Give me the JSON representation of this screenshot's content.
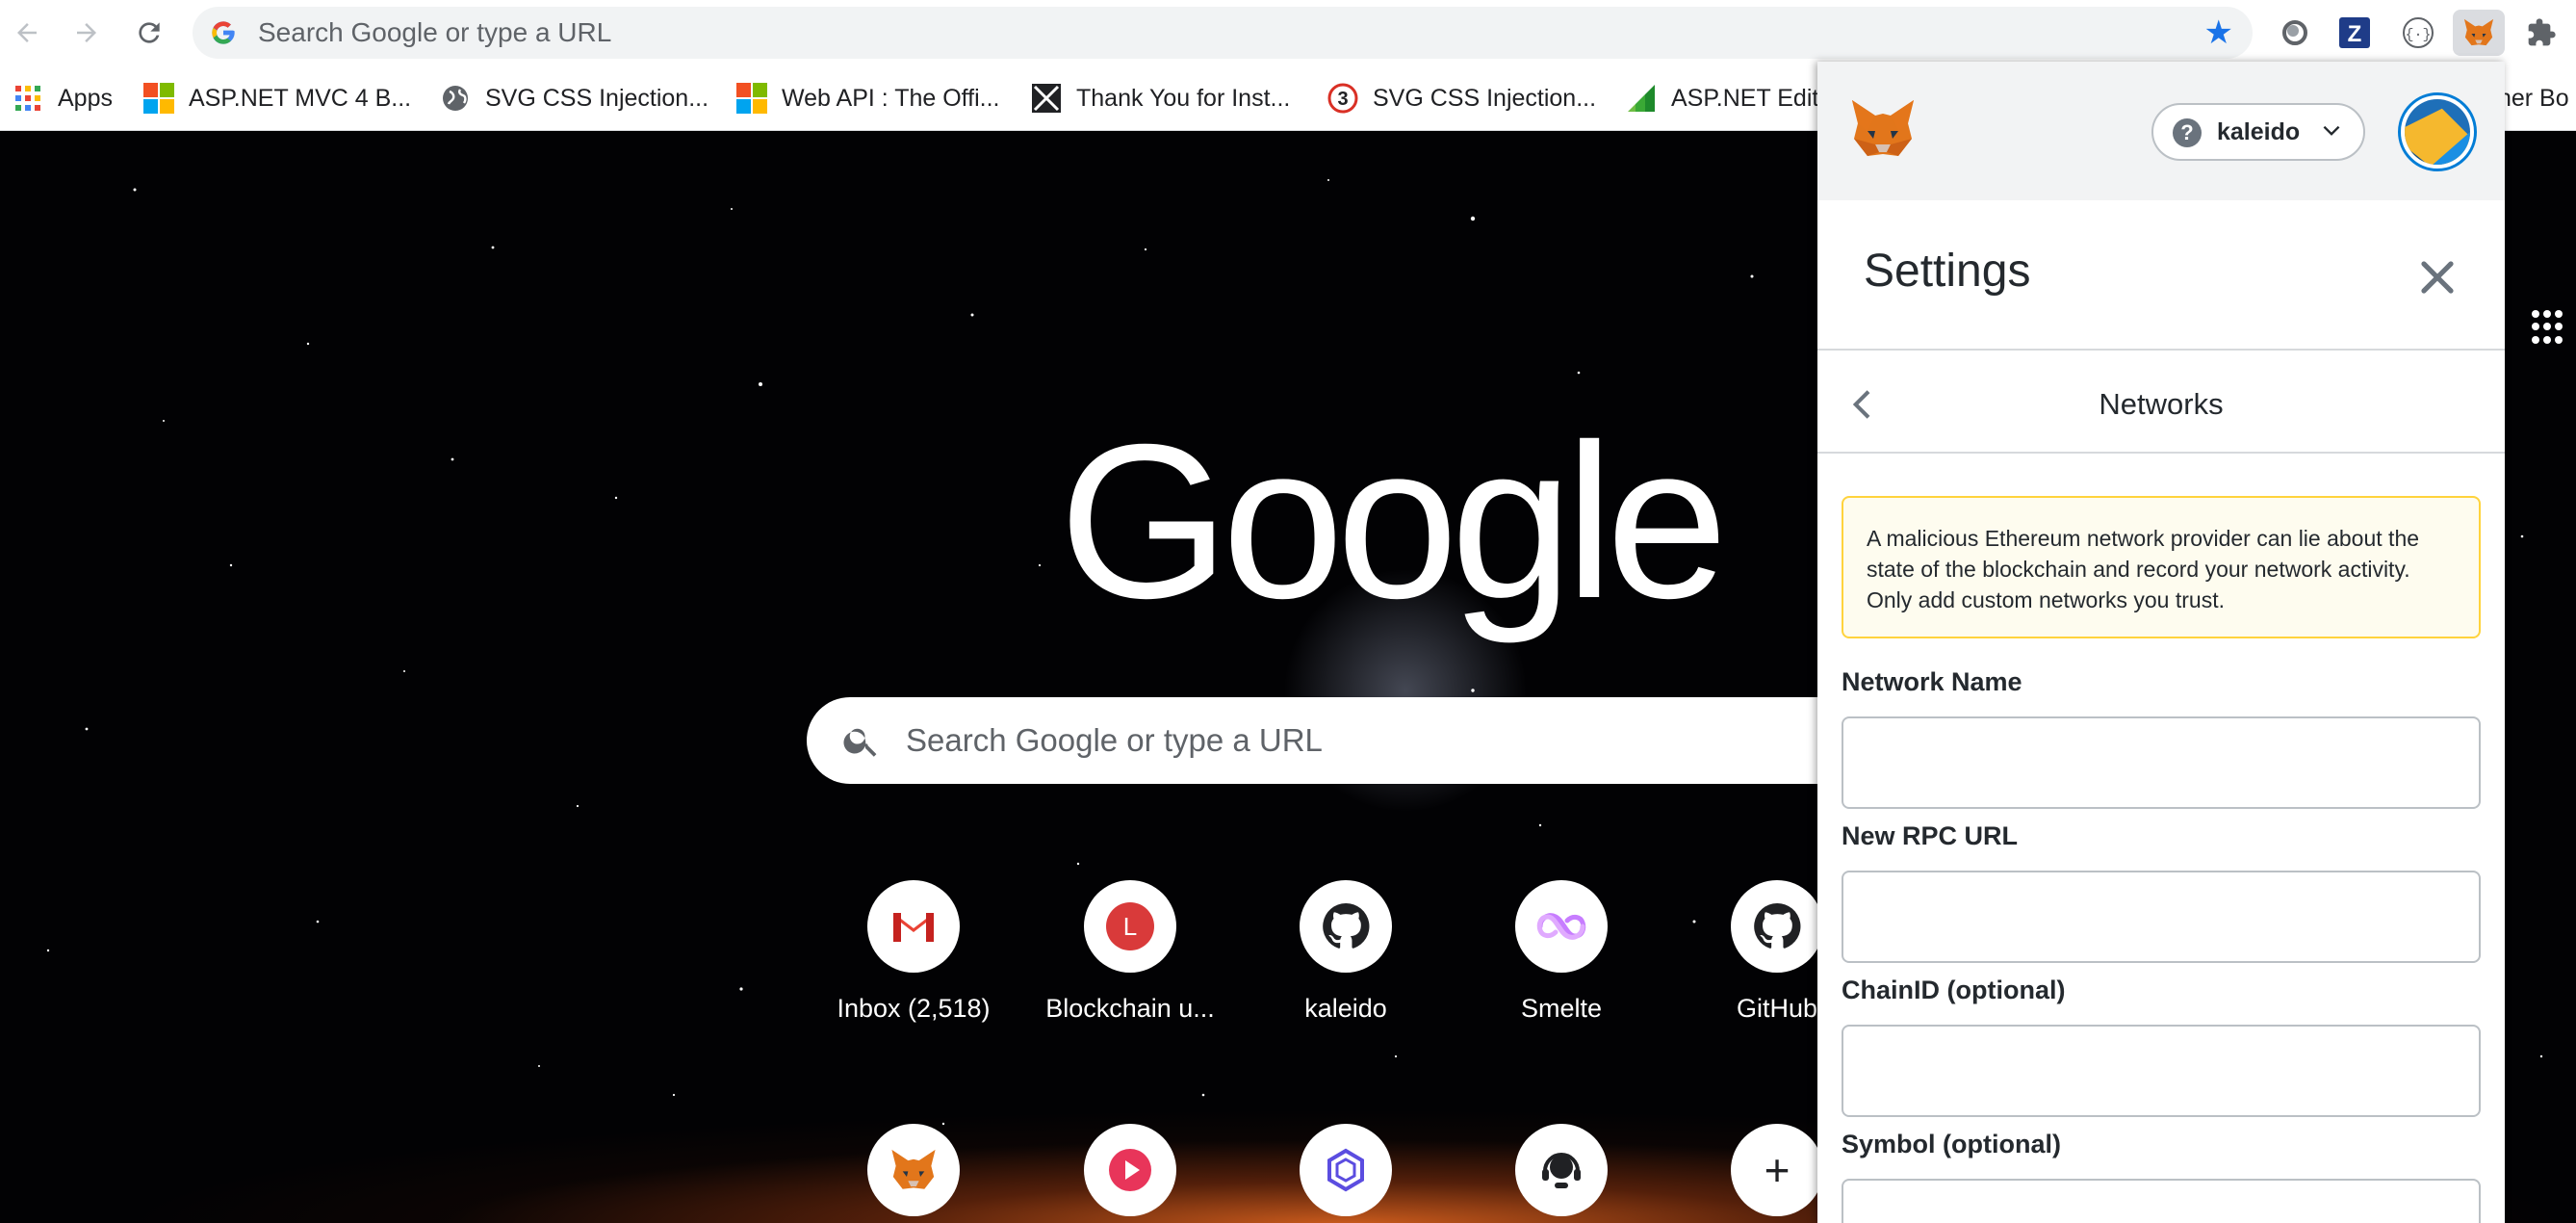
{
  "browser": {
    "omnibox_text": "Search Google or type a URL"
  },
  "bookmarks": [
    {
      "label": "Apps"
    },
    {
      "label": "ASP.NET MVC 4 B..."
    },
    {
      "label": "SVG CSS Injection..."
    },
    {
      "label": "Web API : The Offi..."
    },
    {
      "label": "Thank You for Inst..."
    },
    {
      "label": "SVG CSS Injection..."
    },
    {
      "label": "ASP.NET Edit"
    },
    {
      "label": "ther Bo"
    }
  ],
  "ntp": {
    "logo": "Google",
    "search_placeholder": "Search Google or type a URL",
    "shortcuts": [
      {
        "label": "Inbox (2,518)",
        "icon": "gmail-icon"
      },
      {
        "label": "Blockchain u...",
        "icon": "letter-l-icon"
      },
      {
        "label": "kaleido",
        "icon": "github-icon"
      },
      {
        "label": "Smelte",
        "icon": "smelte-icon"
      },
      {
        "label": "GitHub",
        "icon": "github-icon"
      }
    ],
    "row2_icons": [
      "metamask-fox-icon",
      "play-icon",
      "hexagon-logo-icon",
      "support-headset-icon",
      "add-icon"
    ],
    "add_symbol": "+"
  },
  "metamask": {
    "network_name": "kaleido",
    "network_help": "?",
    "settings_title": "Settings",
    "subpage_title": "Networks",
    "warning": "A malicious Ethereum network provider can lie about the state of the blockchain and record your network activity. Only add custom networks you trust.",
    "fields": [
      {
        "label": "Network Name",
        "value": ""
      },
      {
        "label": "New RPC URL",
        "value": ""
      },
      {
        "label": "ChainID (optional)",
        "value": ""
      },
      {
        "label": "Symbol (optional)",
        "value": ""
      }
    ]
  },
  "colors": {
    "chrome_blue": "#1a73e8",
    "metamask_orange": "#f6851b",
    "warning_border": "#ffd33d",
    "warning_bg": "#fefcef"
  }
}
